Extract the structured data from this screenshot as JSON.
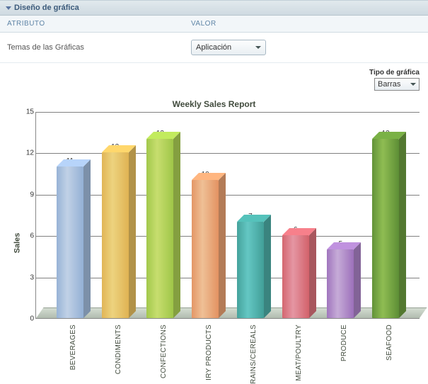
{
  "panel": {
    "title": "Diseño de gráfica",
    "col_attribute": "ATRIBUTO",
    "col_value": "VALOR",
    "theme_label": "Temas de las Gráficas",
    "theme_value": "Aplicación",
    "type_label": "Tipo de gráfica",
    "type_value": "Barras"
  },
  "chart_data": {
    "type": "bar",
    "title": "Weekly Sales Report",
    "ylabel": "Sales",
    "xlabel": "",
    "ylim": [
      0,
      15
    ],
    "yticks": [
      0,
      3,
      6,
      9,
      12,
      15
    ],
    "categories": [
      "BEVERAGES",
      "CONDIMENTS",
      "CONFECTIONS",
      "IRY PRODUCTS",
      "RAINS/CEREALS",
      "MEAT/POULTRY",
      "PRODUCE",
      "SEAFOOD"
    ],
    "values": [
      11,
      12,
      13,
      10,
      7,
      6,
      5,
      13
    ],
    "colors": [
      "#9fb8d9",
      "#e3bb5e",
      "#a9cc52",
      "#e69e6f",
      "#4aa9a3",
      "#d76f79",
      "#a77fc2",
      "#6a9a3d"
    ]
  }
}
